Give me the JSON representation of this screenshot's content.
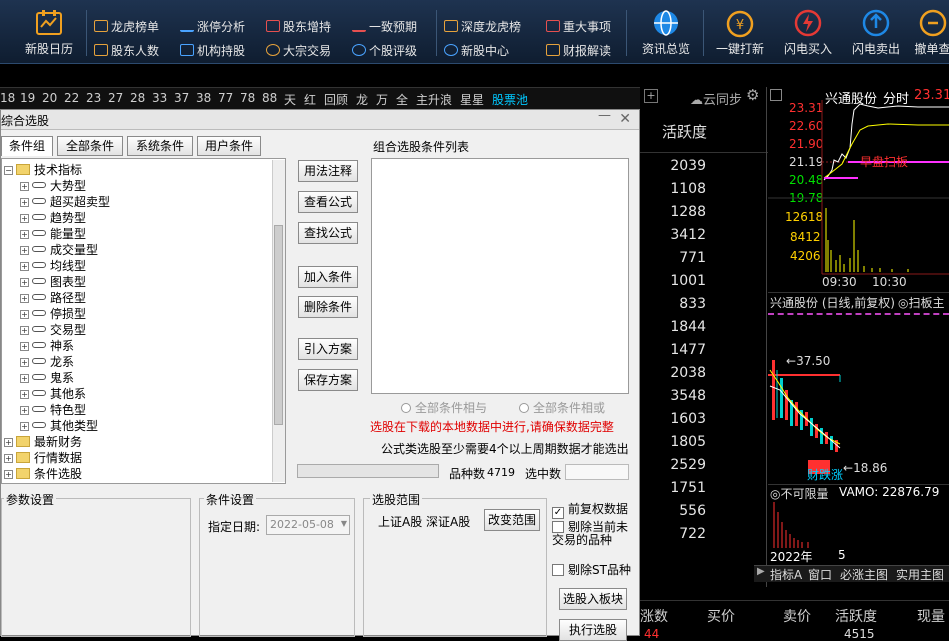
{
  "toolbar": {
    "big_items": [
      {
        "label": "新股日历",
        "icon": "calendar-chart-icon"
      },
      {
        "label": "资讯总览",
        "icon": "globe-icon"
      },
      {
        "label": "一键打新",
        "icon": "money-bag-icon"
      },
      {
        "label": "闪电买入",
        "icon": "lightning-buy-icon"
      },
      {
        "label": "闪电卖出",
        "icon": "lightning-sell-icon"
      },
      {
        "label": "撤单查",
        "icon": "cancel-order-icon"
      }
    ],
    "small_items": [
      {
        "label": "龙虎榜单"
      },
      {
        "label": "股东人数"
      },
      {
        "label": "涨停分析"
      },
      {
        "label": "机构持股"
      },
      {
        "label": "股东增持"
      },
      {
        "label": "大宗交易"
      },
      {
        "label": "一致预期"
      },
      {
        "label": "个股评级"
      },
      {
        "label": "深度龙虎榜"
      },
      {
        "label": "新股中心"
      },
      {
        "label": "重大事项"
      },
      {
        "label": "财报解读"
      }
    ]
  },
  "tabbar": {
    "items": [
      "18",
      "19",
      "20",
      "22",
      "23",
      "27",
      "28",
      "33",
      "37",
      "38",
      "77",
      "78",
      "88",
      "天",
      "红",
      "回顾",
      "龙",
      "万",
      "全",
      "主升浪",
      "星星",
      "股票池"
    ],
    "active": "股票池"
  },
  "dialog": {
    "title": "综合选股",
    "tabs": [
      "条件组",
      "全部条件",
      "系统条件",
      "用户条件"
    ],
    "tree": {
      "root": "技术指标",
      "children": [
        "大势型",
        "超买超卖型",
        "趋势型",
        "能量型",
        "成交量型",
        "均线型",
        "图表型",
        "路径型",
        "停损型",
        "交易型",
        "神系",
        "龙系",
        "鬼系",
        "其他系",
        "特色型",
        "其他类型"
      ],
      "others": [
        "最新财务",
        "行情数据",
        "条件选股"
      ]
    },
    "mid_buttons": [
      "用法注释",
      "查看公式",
      "查找公式",
      "加入条件",
      "删除条件",
      "引入方案",
      "保存方案"
    ],
    "cond_list_title": "组合选股条件列表",
    "radio_and": "全部条件相与",
    "radio_or": "全部条件相或",
    "warning": "选股在下载的本地数据中进行,请确保数据完整",
    "note": "公式类选股至少需要4个以上周期数据才能选出",
    "count_label": "品种数",
    "count_value": "4719",
    "selected_label": "选中数",
    "selected_value": "",
    "params_title": "参数设置",
    "cond_settings_title": "条件设置",
    "date_label": "指定日期:",
    "date_value": "2022-05-08",
    "range_title": "选股范围",
    "range_text": "上证A股 深证A股",
    "range_button": "改变范围",
    "check_fq": "前复权数据",
    "check_fq_checked": true,
    "check_exclude": "剔除当前未交易的品种",
    "check_st": "剔除ST品种",
    "btn_to_block": "选股入板块",
    "btn_execute": "执行选股"
  },
  "right": {
    "sync_label": "云同步",
    "activity_header": "活跃度",
    "activity_values": [
      "2039",
      "1108",
      "1288",
      "3412",
      "771",
      "1001",
      "833",
      "1844",
      "1477",
      "2038",
      "3548",
      "1603",
      "1805",
      "2529",
      "1751",
      "556",
      "722"
    ],
    "stock_name": "兴通股份",
    "time_label": "分时",
    "last_price": "23.31",
    "price_ticks": [
      "23.31",
      "22.60",
      "21.90",
      "21.19",
      "20.48",
      "19.78"
    ],
    "volume_ticks": [
      "12618",
      "8412",
      "4206"
    ],
    "time_ticks": [
      "09:30",
      "10:30"
    ],
    "signal_label": "早盘扫板",
    "kline_title": "兴通股份 (日线,前复权)",
    "kline_extra": "扫板主",
    "kline_high": "37.50",
    "kline_low": "18.86",
    "kline_tag": "财跌涨",
    "vol_title": "不可限量",
    "vamo": "VAMO: 22876.79",
    "date_axis": [
      "2022年",
      "5"
    ],
    "bottom_tabs": [
      "指标A",
      "窗口",
      "必涨主图",
      "实用主图"
    ],
    "bottom_headers": [
      "涨数",
      "买价",
      "卖价",
      "活跃度",
      "现量"
    ],
    "partial_row": [
      "44",
      "4515"
    ]
  },
  "colors": {
    "accent": "#00c8ff",
    "warning": "#e00000",
    "up": "#ff3030",
    "down": "#00d0d0",
    "yellow": "#ffff00"
  }
}
